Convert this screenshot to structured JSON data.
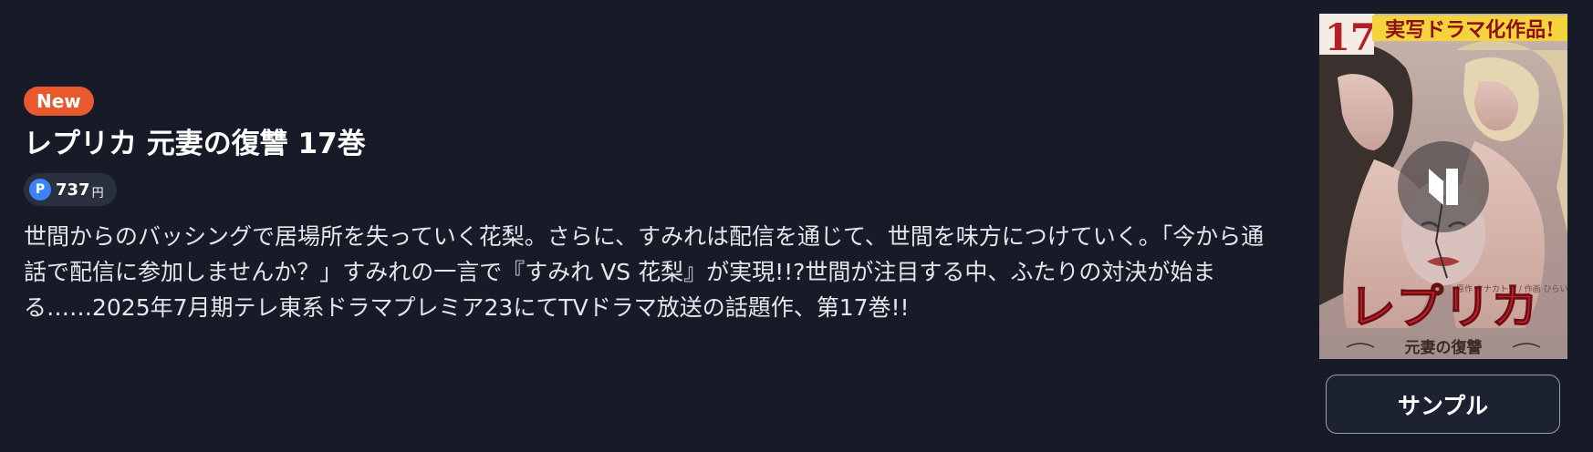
{
  "product": {
    "badge": "New",
    "title": "レプリカ 元妻の復讐 17巻",
    "price": {
      "icon_letter": "P",
      "value": "737",
      "unit": "円"
    },
    "description": "世間からのバッシングで居場所を失っていく花梨。さらに、すみれは配信を通じて、世間を味方につけていく。「今から通話で配信に参加しませんか？」すみれの一言で『すみれ VS 花梨』が実現!!?世間が注目する中、ふたりの対決が始まる……2025年7月期テレ東系ドラマプレミア23にてTVドラマ放送の話題作、第17巻!!"
  },
  "cover": {
    "volume_number": "17",
    "banner": "実写ドラマ化作品!",
    "title_art": "レプリカ",
    "subtitle_art": "元妻の復讐",
    "credits_art": "原作 タナカトモ / 作画 ひらいゆか",
    "play_icon": "play-pause-icon"
  },
  "actions": {
    "sample_label": "サンプル"
  },
  "colors": {
    "background": "#161b27",
    "badge": "#e8592d",
    "point_icon": "#3b82f6",
    "price_pill": "#2a303e",
    "cover_title_red": "#c8202a"
  }
}
